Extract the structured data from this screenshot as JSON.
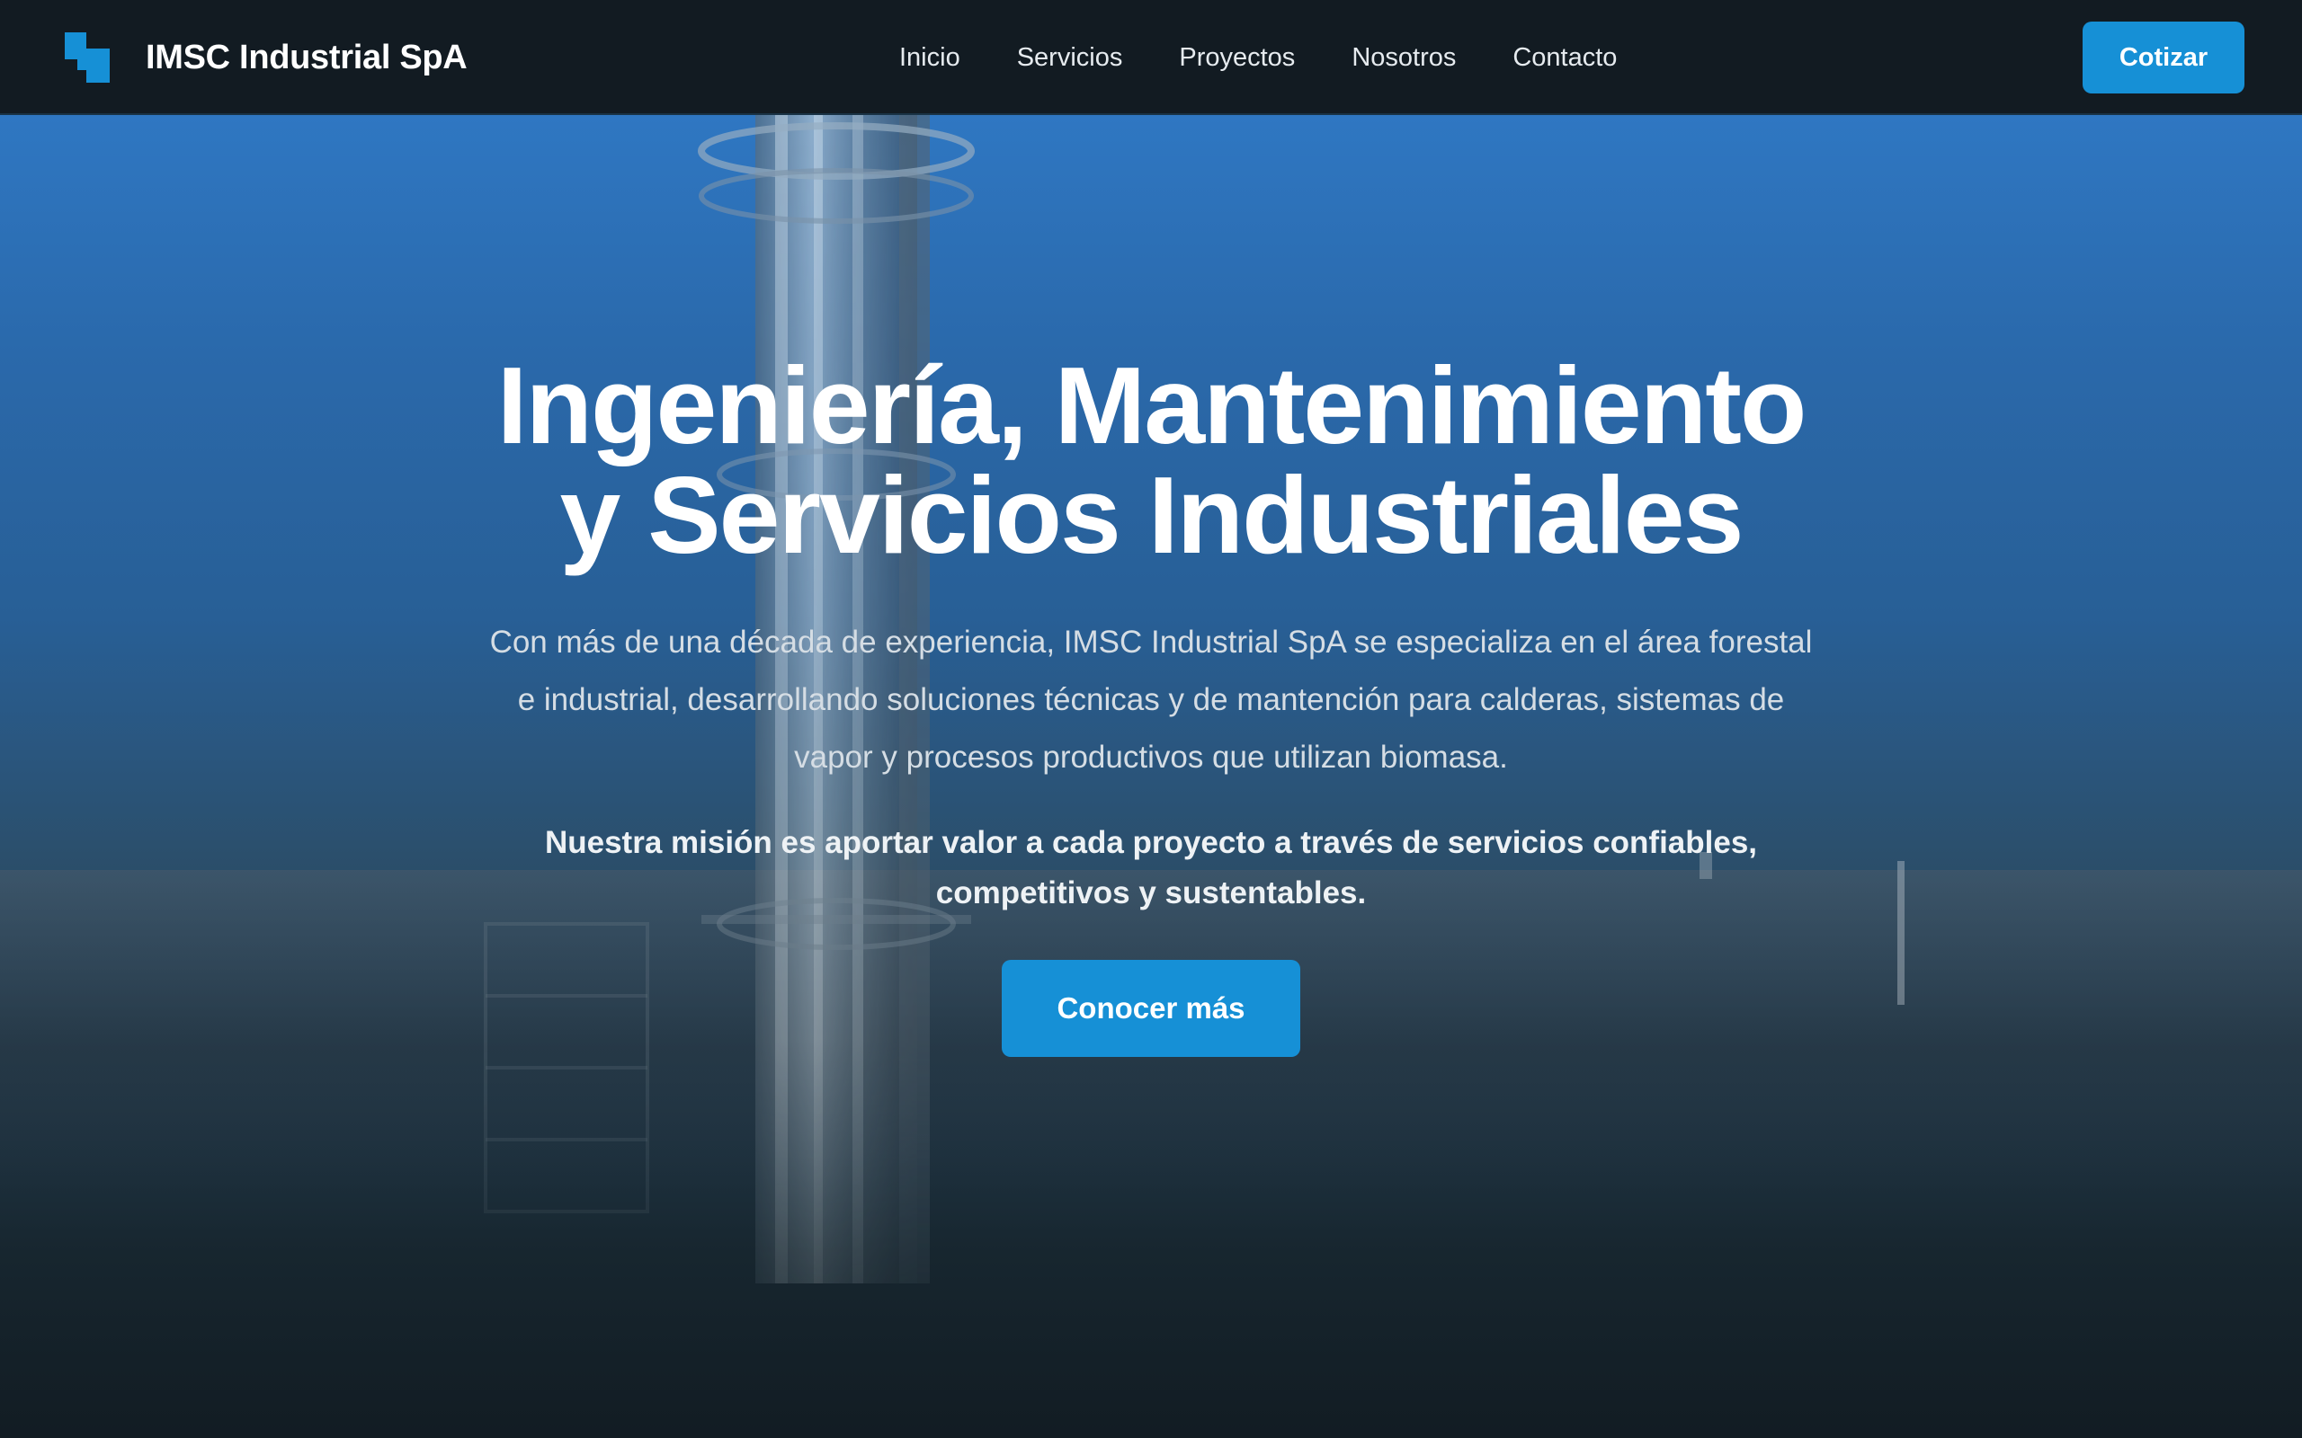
{
  "brand": {
    "name": "IMSC Industrial SpA",
    "icon": "brand-logo-icon",
    "accent_color": "#1690d6"
  },
  "nav": {
    "items": [
      {
        "label": "Inicio"
      },
      {
        "label": "Servicios"
      },
      {
        "label": "Proyectos"
      },
      {
        "label": "Nosotros"
      },
      {
        "label": "Contacto"
      }
    ],
    "cta_label": "Cotizar"
  },
  "hero": {
    "title_line1": "Ingeniería, Mantenimiento",
    "title_line2": "y Servicios Industriales",
    "description": "Con más de una década de experiencia, IMSC Industrial SpA se especializa en el área forestal e industrial, desarrollando soluciones técnicas y de mantención para calderas, sistemas de vapor y procesos productivos que utilizan biomasa.",
    "mission": "Nuestra misión es aportar valor a cada proyecto a través de servicios confiables, competitivos y sustentables.",
    "cta_label": "Conocer más",
    "background_image": "industrial-chimney-tower"
  },
  "colors": {
    "nav_background": "#121b22",
    "button": "#1690d6",
    "page_background": "#121c23"
  }
}
